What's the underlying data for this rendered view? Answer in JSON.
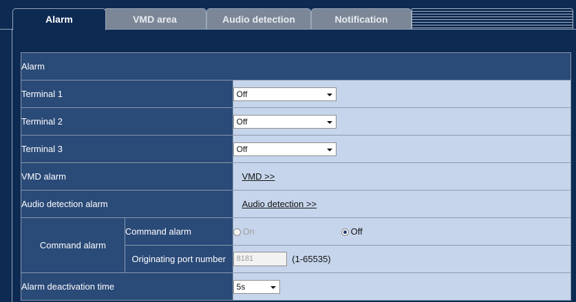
{
  "tabs": [
    {
      "label": "Alarm",
      "active": true
    },
    {
      "label": "VMD area",
      "active": false
    },
    {
      "label": "Audio detection",
      "active": false
    },
    {
      "label": "Notification",
      "active": false
    }
  ],
  "section": {
    "title": "Alarm"
  },
  "rows": {
    "terminal1": {
      "label": "Terminal 1",
      "value": "Off"
    },
    "terminal2": {
      "label": "Terminal 2",
      "value": "Off"
    },
    "terminal3": {
      "label": "Terminal 3",
      "value": "Off"
    },
    "vmd_alarm": {
      "label": "VMD alarm",
      "link": "VMD >>"
    },
    "audio_alarm": {
      "label": "Audio detection alarm",
      "link": "Audio detection >>"
    },
    "command_alarm": {
      "label": "Command alarm",
      "sub_label": "Command alarm",
      "option_on": "On",
      "option_off": "Off",
      "selected": "Off",
      "port_label": "Originating port number",
      "port_value": "8181",
      "port_range": "(1-65535)"
    },
    "deactivation": {
      "label": "Alarm deactivation time",
      "value": "5s"
    }
  },
  "colors": {
    "background": "#0d2a52",
    "label_cell": "#2a4a78",
    "value_cell": "#c6d5eb"
  }
}
